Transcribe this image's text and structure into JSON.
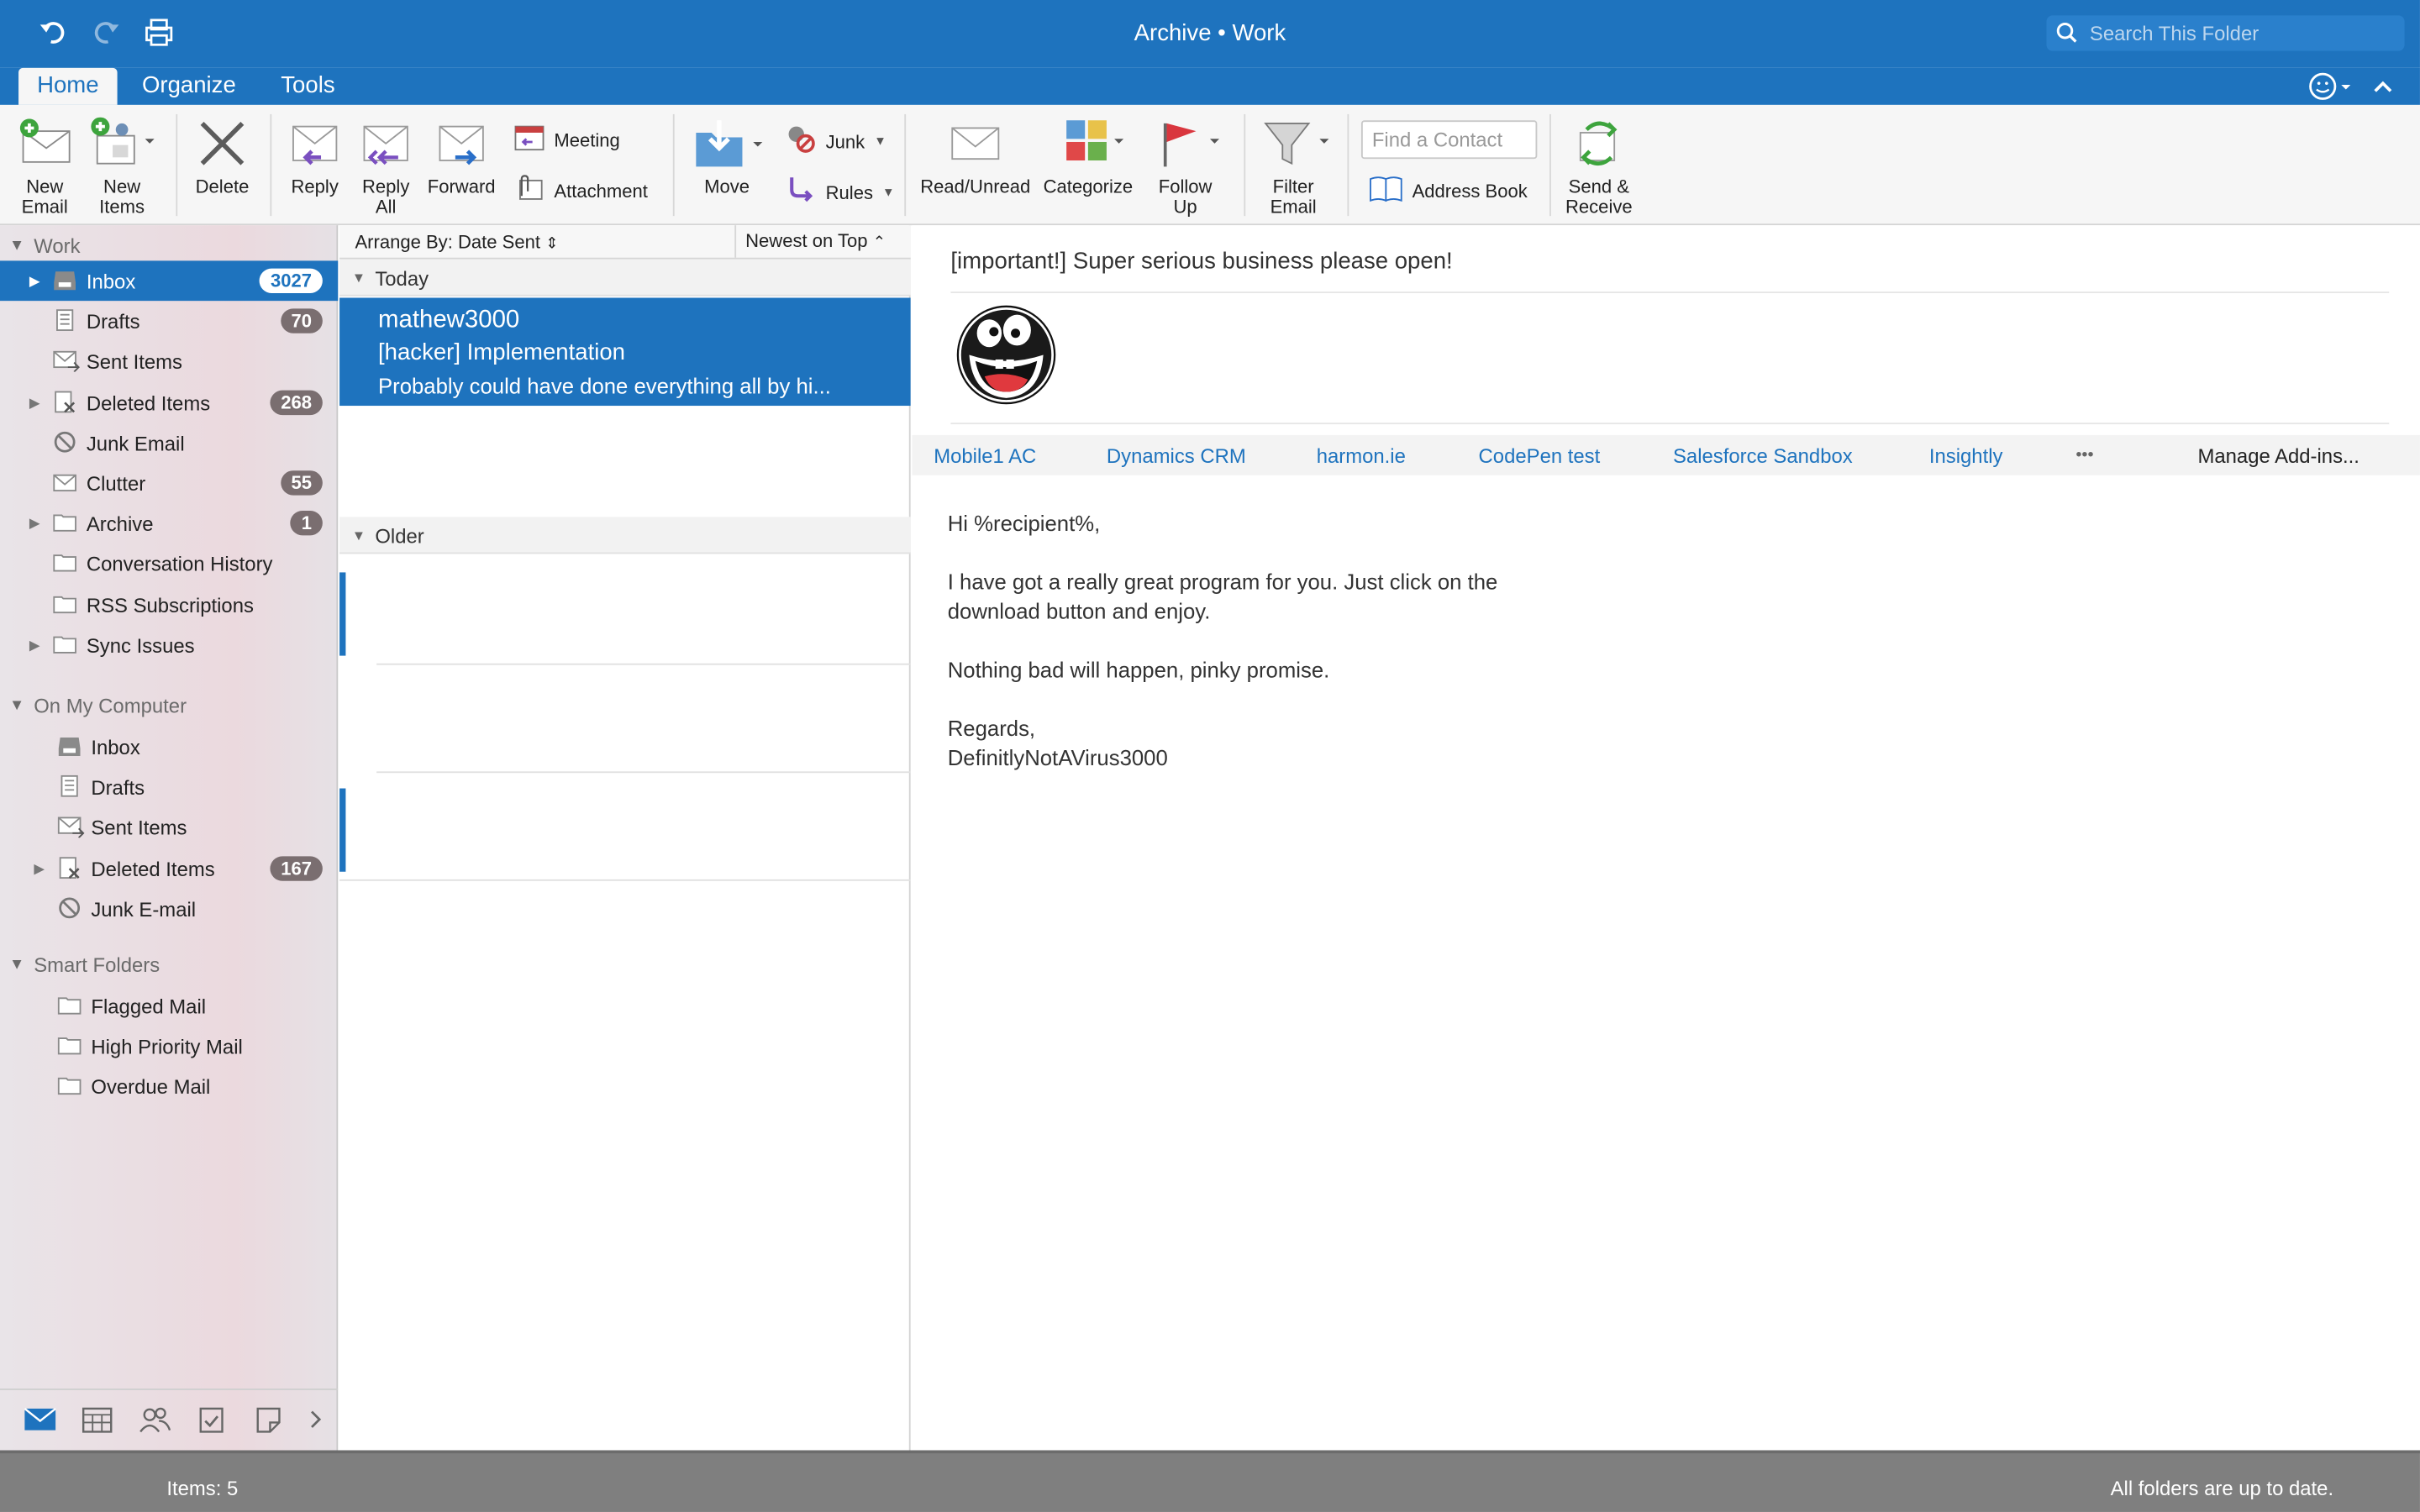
{
  "window": {
    "title": "Archive • Work"
  },
  "search": {
    "placeholder": "Search This Folder"
  },
  "tabs": [
    {
      "label": "Home",
      "active": true
    },
    {
      "label": "Organize",
      "active": false
    },
    {
      "label": "Tools",
      "active": false
    }
  ],
  "ribbon": {
    "new_email": "New\nEmail",
    "new_items": "New\nItems",
    "delete": "Delete",
    "reply": "Reply",
    "reply_all": "Reply\nAll",
    "forward": "Forward",
    "meeting": "Meeting",
    "attachment": "Attachment",
    "move": "Move",
    "junk": "Junk",
    "rules": "Rules",
    "read_unread": "Read/Unread",
    "categorize": "Categorize",
    "follow_up": "Follow\nUp",
    "filter_email": "Filter\nEmail",
    "find_contact_placeholder": "Find a Contact",
    "address_book": "Address Book",
    "send_receive": "Send &\nReceive"
  },
  "sidebar": {
    "work_section": "Work",
    "work_folders": [
      {
        "label": "Inbox",
        "count": "3027",
        "selected": true,
        "expandable": true,
        "icon": "inbox-icon"
      },
      {
        "label": "Drafts",
        "count": "70",
        "icon": "drafts-icon"
      },
      {
        "label": "Sent Items",
        "count": "",
        "icon": "sent-icon"
      },
      {
        "label": "Deleted Items",
        "count": "268",
        "expandable": true,
        "icon": "deleted-icon"
      },
      {
        "label": "Junk Email",
        "count": "",
        "icon": "junk-icon"
      },
      {
        "label": "Clutter",
        "count": "55",
        "icon": "clutter-icon"
      },
      {
        "label": "Archive",
        "count": "1",
        "expandable": true,
        "icon": "folder-icon"
      },
      {
        "label": "Conversation History",
        "count": "",
        "icon": "folder-icon"
      },
      {
        "label": "RSS Subscriptions",
        "count": "",
        "icon": "folder-icon"
      },
      {
        "label": "Sync Issues",
        "count": "",
        "expandable": true,
        "icon": "folder-icon"
      }
    ],
    "computer_section": "On My Computer",
    "computer_folders": [
      {
        "label": "Inbox",
        "count": "",
        "icon": "inbox-icon"
      },
      {
        "label": "Drafts",
        "count": "",
        "icon": "drafts-icon"
      },
      {
        "label": "Sent Items",
        "count": "",
        "icon": "sent-icon"
      },
      {
        "label": "Deleted Items",
        "count": "167",
        "expandable": true,
        "icon": "deleted-icon"
      },
      {
        "label": "Junk E-mail",
        "count": "",
        "icon": "junk-icon"
      }
    ],
    "smart_section": "Smart Folders",
    "smart_folders": [
      {
        "label": "Flagged Mail",
        "icon": "folder-icon"
      },
      {
        "label": "High Priority Mail",
        "icon": "folder-icon"
      },
      {
        "label": "Overdue Mail",
        "icon": "folder-icon"
      }
    ]
  },
  "message_list": {
    "arrange_by": "Arrange By: Date Sent",
    "sort_order": "Newest on Top",
    "group_today": "Today",
    "group_older": "Older",
    "selected_message": {
      "from": "mathew3000",
      "subject": "[hacker] Implementation",
      "preview": "Probably could have done everything all by hi..."
    }
  },
  "reading_pane": {
    "subject": "[important!] Super serious business please open!",
    "addins": [
      "Mobile1 AC",
      "Dynamics CRM",
      "harmon.ie",
      "CodePen test",
      "Salesforce Sandbox",
      "Insightly"
    ],
    "more": "•••",
    "manage_addins": "Manage Add-ins...",
    "body": {
      "greeting": "Hi %recipient%,",
      "para1_line1": "I have got a really great program for you. Just click on the",
      "para1_line2": "download button and enjoy.",
      "para2": "Nothing bad will happen, pinky promise.",
      "closing": "Regards,",
      "signature": "DefinitlyNotAVirus3000"
    }
  },
  "status_bar": {
    "items": "Items: 5",
    "sync": "All folders are up to date."
  },
  "colors": {
    "accent": "#1e73be",
    "status": "#7f7f7f"
  }
}
